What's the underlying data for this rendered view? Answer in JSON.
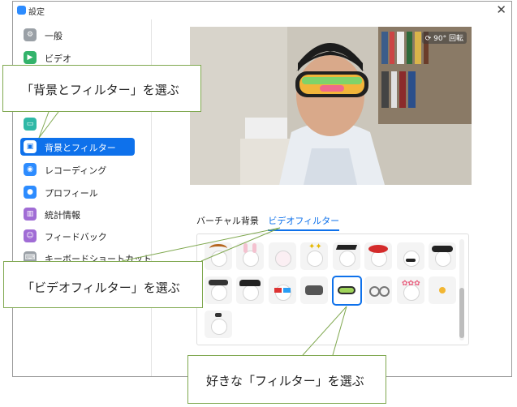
{
  "window": {
    "title": "設定"
  },
  "sidebar": {
    "items": [
      {
        "label": "一般",
        "icon": "gear-icon",
        "color": "#9aa0a6"
      },
      {
        "label": "ビデオ",
        "icon": "video-icon",
        "color": "#33b36b"
      },
      {
        "label": "",
        "icon": "chat-icon",
        "color": "#2fb8a6"
      },
      {
        "label": "背景とフィルター",
        "icon": "background-icon",
        "color": "#0e71eb",
        "active": true
      },
      {
        "label": "レコーディング",
        "icon": "record-icon",
        "color": "#2d8cff"
      },
      {
        "label": "プロフィール",
        "icon": "profile-icon",
        "color": "#2d8cff"
      },
      {
        "label": "統計情報",
        "icon": "stats-icon",
        "color": "#a06cd5"
      },
      {
        "label": "フィードバック",
        "icon": "feedback-icon",
        "color": "#a06cd5"
      },
      {
        "label": "キーボードショートカット",
        "icon": "keyboard-icon",
        "color": "#9aa0a6"
      }
    ]
  },
  "preview": {
    "rotate_label": "90° 回転"
  },
  "tabs": {
    "virtual_background": "バーチャル背景",
    "video_filter": "ビデオフィルター"
  },
  "filters": {
    "row1": [
      "deer-ears-filter",
      "bunny-ears-filter",
      "bunny-face-filter",
      "sparkle-filter",
      "graduation-cap-filter",
      "beret-filter",
      "mustache-filter",
      "ninja-hat-filter"
    ],
    "row2": [
      "sunglasses-hat-filter",
      "fedora-filter",
      "3d-glasses-filter",
      "vr-headset-filter",
      "ski-goggles-filter",
      "round-glasses-filter",
      "flower-crown-filter",
      "sun-filter"
    ],
    "row3": [
      "bow-filter"
    ],
    "selected": "ski-goggles-filter"
  },
  "callouts": {
    "background": "「背景とフィルター」を選ぶ",
    "video_filter": "「ビデオフィルター」を選ぶ",
    "favorite": "好きな「フィルター」を選ぶ"
  }
}
